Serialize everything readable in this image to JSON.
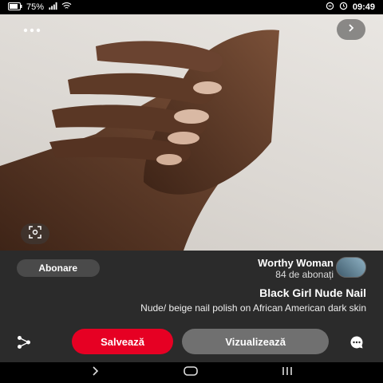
{
  "status_bar": {
    "time": "09:49",
    "battery": "75%"
  },
  "photo": {
    "alt": "hand with nude nails",
    "more_icon": "more-horizontal-icon",
    "back_icon": "chevron-left-icon",
    "lens_icon": "visual-search-icon"
  },
  "pin": {
    "author_name": "Worthy Woman",
    "subscribers": "84 de abonați",
    "follow_label": "Abonare",
    "title": "Black Girl Nude Nail",
    "description": "Nude/ beige nail polish on African American dark skin",
    "view_label": "Vizualizează",
    "save_label": "Salvează"
  },
  "colors": {
    "save": "#e60023",
    "panel": "#2b2b2b",
    "view": "#707070"
  }
}
